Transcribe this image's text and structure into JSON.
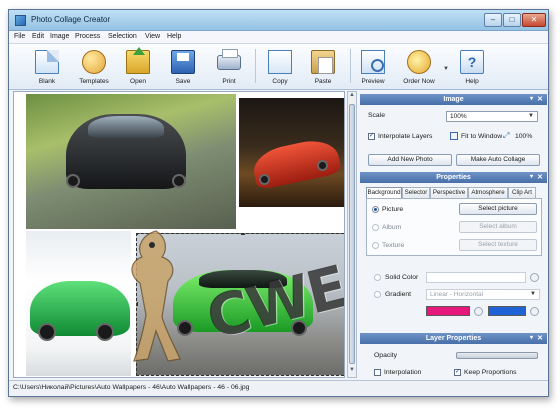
{
  "window": {
    "title": "Photo Collage Creator"
  },
  "menu": [
    "File",
    "Edit",
    "Image",
    "Process",
    "Selection",
    "View",
    "Help"
  ],
  "toolbar": {
    "blank": "Blank",
    "templates": "Templates",
    "open": "Open",
    "save": "Save",
    "print": "Print",
    "copy": "Copy",
    "paste": "Paste",
    "preview": "Preview",
    "order_now": "Order Now",
    "help": "Help"
  },
  "canvas": {
    "watermark": "CWER.RU"
  },
  "image_panel": {
    "header": "Image",
    "scale_label": "Scale",
    "scale_value": "100%",
    "interpolate_label": "Interpolate Layers",
    "interpolate_checked": true,
    "fit_label": "Fit to Window",
    "zoom_label": "100%",
    "add_photo": "Add New Photo",
    "auto_collage": "Make Auto Collage"
  },
  "properties_panel": {
    "header": "Properties",
    "tabs": [
      "Background",
      "Selector",
      "Perspective",
      "Atmosphere",
      "Clip Art"
    ],
    "active_tab": "Background",
    "picture_label": "Picture",
    "select_picture": "Select picture",
    "album_label": "Album",
    "select_album": "Select album",
    "texture_label": "Texture",
    "select_texture": "Select texture",
    "solid_color_label": "Solid Color",
    "gradient_label": "Gradient",
    "gradient_type": "Linear - Horizontal",
    "gradient_color_1": "#e6187c",
    "gradient_color_2": "#1f62d6"
  },
  "layer_panel": {
    "header": "Layer Properties",
    "opacity_label": "Opacity",
    "interpolation_label": "Interpolation",
    "interpolation_checked": false,
    "keep_proportions_label": "Keep Proportions",
    "keep_proportions_checked": true
  },
  "status": {
    "path": "C:\\Users\\Николай\\Pictures\\Auto Wallpapers - 46\\Auto Wallpapers - 46 - 06.jpg"
  }
}
